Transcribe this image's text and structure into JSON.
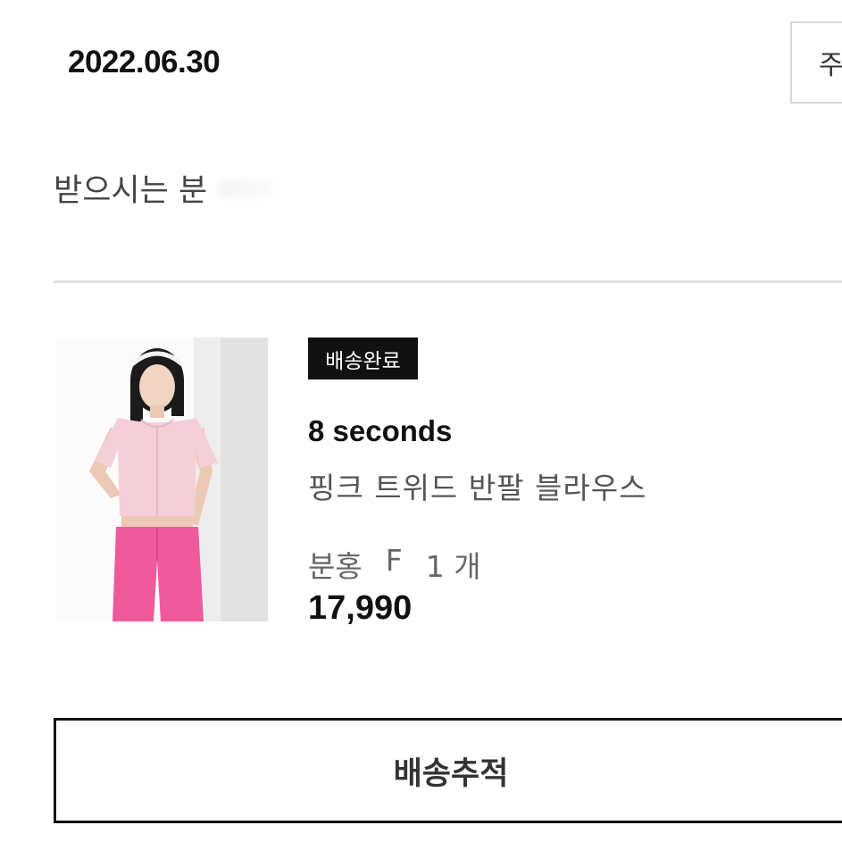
{
  "order": {
    "date": "2022.06.30",
    "detail_button_label": "주"
  },
  "recipient": {
    "label": "받으시는 분"
  },
  "item": {
    "status": "배송완료",
    "brand": "8 seconds",
    "product_name": "핑크 트위드 반팔 블라우스",
    "option_color": "분홍",
    "option_size": "F",
    "option_quantity": "1 개",
    "price": "17,990",
    "image_icon": "product-photo"
  },
  "actions": {
    "tracking_label": "배송추적"
  },
  "colors": {
    "badge_bg": "#111111",
    "top_color": "#f5cfd8",
    "pants_color": "#ee5a9c"
  }
}
